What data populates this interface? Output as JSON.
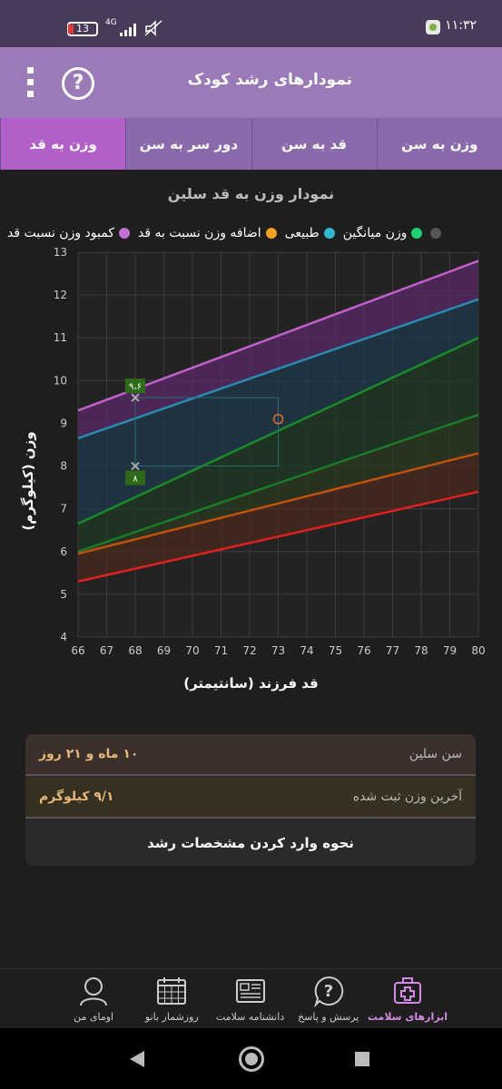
{
  "status": {
    "time": "۱۱:۳۲",
    "battery": "13",
    "network": "4G"
  },
  "app": {
    "title": "نمودارهای رشد کودک",
    "help_icon": "?"
  },
  "tabs": [
    {
      "label": "وزن به سن",
      "active": false
    },
    {
      "label": "قد به سن",
      "active": false
    },
    {
      "label": "دور سر به سن",
      "active": false
    },
    {
      "label": "وزن به قد",
      "active": true
    }
  ],
  "chart_title": "نمودار وزن به قد سلین",
  "legend": [
    {
      "label": "کمبود وزن نسبت قد",
      "color": "#c070d0"
    },
    {
      "label": "اضافه وزن نسبت به قد",
      "color": "#f0a020"
    },
    {
      "label": "طبیعی",
      "color": "#30b8d0"
    },
    {
      "label": "وزن میانگین",
      "color": "#20d070"
    },
    {
      "label": "",
      "color": "#555555"
    }
  ],
  "chart_data": {
    "type": "line",
    "xlabel": "قد فرزند (سانتیمتر)",
    "ylabel": "وزن (کیلوگرم)",
    "xlim": [
      66,
      80
    ],
    "ylim": [
      4,
      13
    ],
    "x_ticks": [
      66,
      67,
      68,
      69,
      70,
      71,
      72,
      73,
      74,
      75,
      76,
      77,
      78,
      79,
      80
    ],
    "y_ticks": [
      4,
      5,
      6,
      7,
      8,
      9,
      10,
      11,
      12,
      13
    ],
    "grid": true,
    "series": [
      {
        "color": "#c060c8",
        "fill": "#5a2a6a",
        "points": [
          [
            66,
            9.3
          ],
          [
            80,
            12.8
          ]
        ]
      },
      {
        "color": "#2a8ab0",
        "fill": "#1e3a4a",
        "points": [
          [
            66,
            8.65
          ],
          [
            80,
            11.9
          ]
        ]
      },
      {
        "color": "#1a8a2a",
        "fill": "#1e3a22",
        "points": [
          [
            66,
            6.65
          ],
          [
            80,
            11.0
          ]
        ]
      },
      {
        "color": "#1a7a2a",
        "fill": "#2a3a1e",
        "points": [
          [
            66,
            6.0
          ],
          [
            80,
            9.2
          ]
        ]
      },
      {
        "color": "#c05010",
        "fill": "#4a2a1e",
        "points": [
          [
            66,
            5.95
          ],
          [
            80,
            8.3
          ]
        ]
      },
      {
        "color": "#e02020",
        "fill": "#4a1e1e",
        "points": [
          [
            66,
            5.3
          ],
          [
            80,
            7.4
          ]
        ]
      }
    ],
    "markers": [
      {
        "x": 68,
        "y": 9.6,
        "label": "۹،۶"
      },
      {
        "x": 68,
        "y": 8.0,
        "label": "۸"
      }
    ],
    "highlight_point": {
      "x": 73,
      "y": 9.1
    }
  },
  "info": {
    "age_label": "سن سلین",
    "age_value": "۱۰ ماه و ۲۱ روز",
    "weight_label": "آخرین وزن ثبت شده",
    "weight_value": "۹/۱ کیلوگرم",
    "link": "نحوه وارد کردن مشخصات رشد"
  },
  "bottom_nav": [
    {
      "label": "ابزارهای سلامت",
      "icon": "medical-kit-icon",
      "active": true
    },
    {
      "label": "پرسش و پاسخ",
      "icon": "question-bubble-icon",
      "active": false
    },
    {
      "label": "دانشنامه سلامت",
      "icon": "newspaper-icon",
      "active": false
    },
    {
      "label": "روزشمار بانو",
      "icon": "calendar-icon",
      "active": false
    },
    {
      "label": "اومای من",
      "icon": "profile-icon",
      "active": false
    }
  ]
}
